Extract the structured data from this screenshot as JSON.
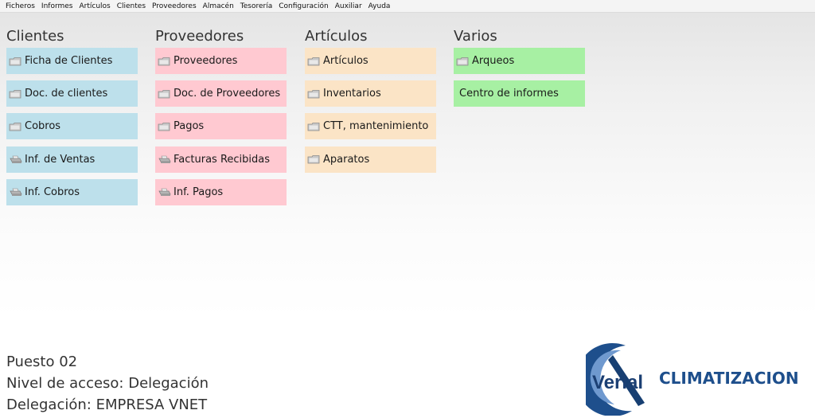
{
  "menu": [
    "Ficheros",
    "Informes",
    "Artículos",
    "Clientes",
    "Proveedores",
    "Almacén",
    "Tesorería",
    "Configuración",
    "Auxiliar",
    "Ayuda"
  ],
  "colors": {
    "clientes": "#bde0eb",
    "proveedores": "#ffc9d1",
    "articulos": "#fbe4c6",
    "varios": "#a7f0a3",
    "brand": "#1e4f8c"
  },
  "columns": [
    {
      "title": "Clientes",
      "items": [
        {
          "label": "Ficha de Clientes",
          "icon": "folder-icon"
        },
        {
          "label": "Doc. de clientes",
          "icon": "folder-icon"
        },
        {
          "label": "Cobros",
          "icon": "folder-icon"
        },
        {
          "label": "Inf. de Ventas",
          "icon": "printer-icon"
        },
        {
          "label": "Inf. Cobros",
          "icon": "printer-icon"
        }
      ]
    },
    {
      "title": "Proveedores",
      "items": [
        {
          "label": "Proveedores",
          "icon": "folder-icon"
        },
        {
          "label": "Doc. de Proveedores",
          "icon": "folder-icon"
        },
        {
          "label": "Pagos",
          "icon": "folder-icon"
        },
        {
          "label": "Facturas Recibidas",
          "icon": "printer-icon"
        },
        {
          "label": "Inf. Pagos",
          "icon": "printer-icon"
        }
      ]
    },
    {
      "title": "Artículos",
      "items": [
        {
          "label": "Artículos",
          "icon": "folder-icon"
        },
        {
          "label": "Inventarios",
          "icon": "folder-icon"
        },
        {
          "label": "CTT, mantenimiento",
          "icon": "folder-icon"
        },
        {
          "label": "Aparatos",
          "icon": "folder-icon"
        }
      ]
    },
    {
      "title": "Varios",
      "items": [
        {
          "label": "Arqueos",
          "icon": "folder-icon"
        },
        {
          "label": "Centro de informes",
          "icon": ""
        }
      ]
    }
  ],
  "status": {
    "puesto": "Puesto 02",
    "nivel": "Nivel de acceso: Delegación",
    "delegacion": "Delegación: EMPRESA VNET"
  },
  "logo": {
    "brand": "Verial",
    "tagline": "CLIMATIZACION"
  }
}
